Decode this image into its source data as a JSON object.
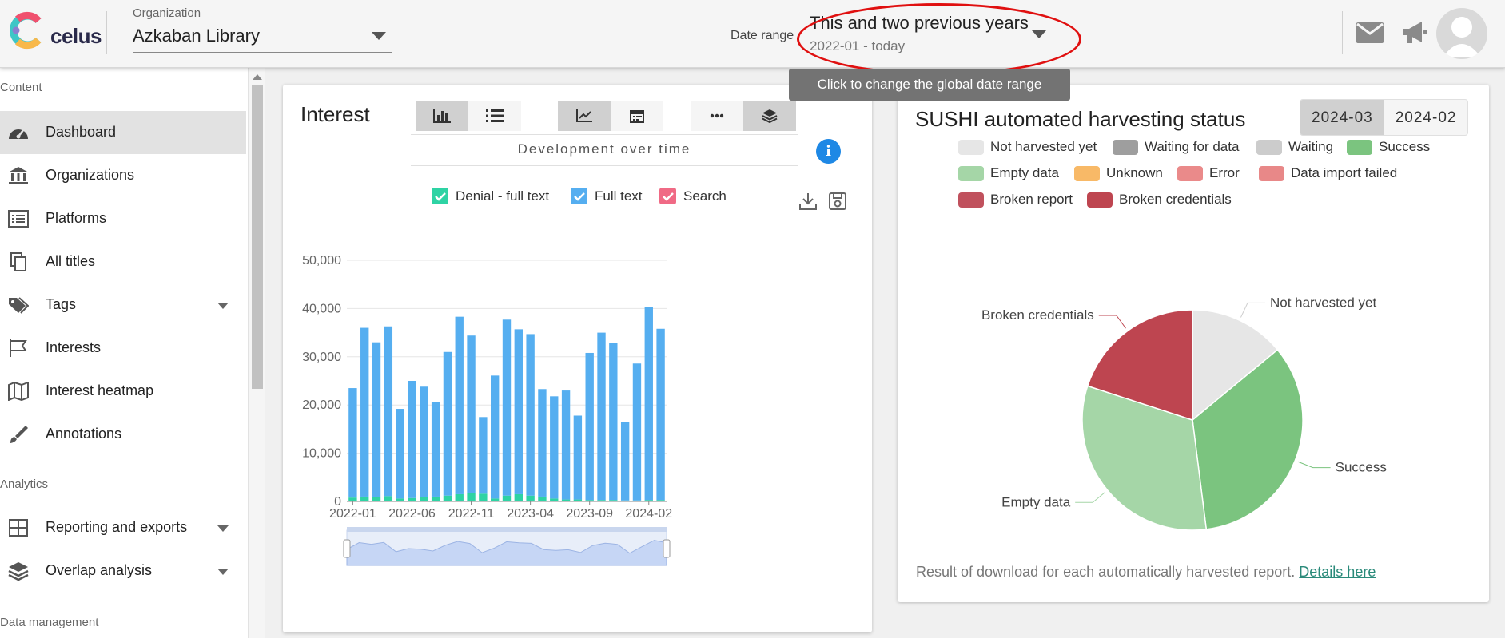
{
  "header": {
    "logo_text": "celus",
    "org_label": "Organization",
    "org_value": "Azkaban Library",
    "date_range_label": "Date range",
    "date_range_value": "This and two previous years",
    "date_range_sub": "2022-01 - today",
    "tooltip": "Click to change the global date range",
    "icons": [
      "mail-icon",
      "megaphone-icon",
      "avatar-icon"
    ]
  },
  "sidebar": {
    "sections": [
      {
        "title": "Content",
        "items": [
          {
            "label": "Dashboard",
            "icon": "gauge-icon",
            "active": true
          },
          {
            "label": "Organizations",
            "icon": "bank-icon"
          },
          {
            "label": "Platforms",
            "icon": "list-icon"
          },
          {
            "label": "All titles",
            "icon": "copy-icon"
          },
          {
            "label": "Tags",
            "icon": "tags-icon",
            "expandable": true
          },
          {
            "label": "Interests",
            "icon": "flag-icon"
          },
          {
            "label": "Interest heatmap",
            "icon": "map-icon"
          },
          {
            "label": "Annotations",
            "icon": "brush-icon"
          }
        ]
      },
      {
        "title": "Analytics",
        "items": [
          {
            "label": "Reporting and exports",
            "icon": "grid-icon",
            "expandable": true
          },
          {
            "label": "Overlap analysis",
            "icon": "layers-icon",
            "expandable": true
          }
        ]
      },
      {
        "title": "Data management",
        "items": []
      }
    ]
  },
  "interest_card": {
    "title": "Interest",
    "mode_label": "Development over time",
    "legend": [
      {
        "label": "Denial - full text",
        "color": "#2ed3a4"
      },
      {
        "label": "Full text",
        "color": "#55aef0"
      },
      {
        "label": "Search",
        "color": "#f06a85"
      }
    ]
  },
  "chart_data": {
    "type": "bar",
    "stacked": true,
    "categories": [
      "2022-01",
      "2022-02",
      "2022-03",
      "2022-04",
      "2022-05",
      "2022-06",
      "2022-07",
      "2022-08",
      "2022-09",
      "2022-10",
      "2022-11",
      "2022-12",
      "2023-01",
      "2023-02",
      "2023-03",
      "2023-04",
      "2023-05",
      "2023-06",
      "2023-07",
      "2023-08",
      "2023-09",
      "2023-10",
      "2023-11",
      "2023-12",
      "2024-01",
      "2024-02",
      "2024-03"
    ],
    "x_tick_labels": [
      "2022-01",
      "2022-06",
      "2022-11",
      "2023-04",
      "2023-09",
      "2024-02"
    ],
    "series": [
      {
        "name": "Denial - full text",
        "color": "#2ed3a4",
        "values": [
          800,
          1000,
          900,
          1100,
          600,
          700,
          900,
          1000,
          1200,
          1500,
          1700,
          1600,
          600,
          1200,
          1500,
          1200,
          1000,
          600,
          400,
          400,
          300,
          300,
          300,
          200,
          200,
          300,
          300
        ]
      },
      {
        "name": "Full text",
        "color": "#55aef0",
        "values": [
          22700,
          35000,
          32100,
          35200,
          18600,
          24300,
          22900,
          19600,
          29800,
          36800,
          32700,
          15900,
          25500,
          36500,
          34200,
          33500,
          22300,
          21200,
          22600,
          17400,
          30500,
          34700,
          32500,
          16300,
          28400,
          40000,
          35500
        ]
      },
      {
        "name": "Search",
        "color": "#f06a85",
        "values": [
          0,
          0,
          0,
          0,
          0,
          0,
          0,
          0,
          0,
          0,
          0,
          0,
          0,
          0,
          0,
          0,
          0,
          0,
          0,
          0,
          0,
          0,
          0,
          0,
          0,
          0,
          0
        ]
      }
    ],
    "y_ticks": [
      "0",
      "10,000",
      "20,000",
      "30,000",
      "40,000",
      "50,000"
    ],
    "ylim": [
      0,
      50000
    ]
  },
  "sushi_card": {
    "title": "SUSHI automated harvesting status",
    "months": [
      "2024-03",
      "2024-02"
    ],
    "legend": [
      {
        "label": "Not harvested yet",
        "color": "#e6e6e6"
      },
      {
        "label": "Waiting for data",
        "color": "#9e9e9e"
      },
      {
        "label": "Waiting",
        "color": "#cccccc"
      },
      {
        "label": "Success",
        "color": "#7bc47f"
      },
      {
        "label": "Empty data",
        "color": "#a5d6a7"
      },
      {
        "label": "Unknown",
        "color": "#f8b967"
      },
      {
        "label": "Error",
        "color": "#ea8a8a"
      },
      {
        "label": "Data import failed",
        "color": "#e88888"
      },
      {
        "label": "Broken report",
        "color": "#c0515d"
      },
      {
        "label": "Broken credentials",
        "color": "#be4550"
      }
    ],
    "pie": [
      {
        "label": "Not harvested yet",
        "value": 14,
        "color": "#e6e6e6"
      },
      {
        "label": "Success",
        "value": 34,
        "color": "#7bc47f"
      },
      {
        "label": "Empty data",
        "value": 32,
        "color": "#a5d6a7"
      },
      {
        "label": "Broken credentials",
        "value": 20,
        "color": "#be4550"
      }
    ],
    "footer_text": "Result of download for each automatically harvested report.",
    "footer_link": "Details here"
  }
}
